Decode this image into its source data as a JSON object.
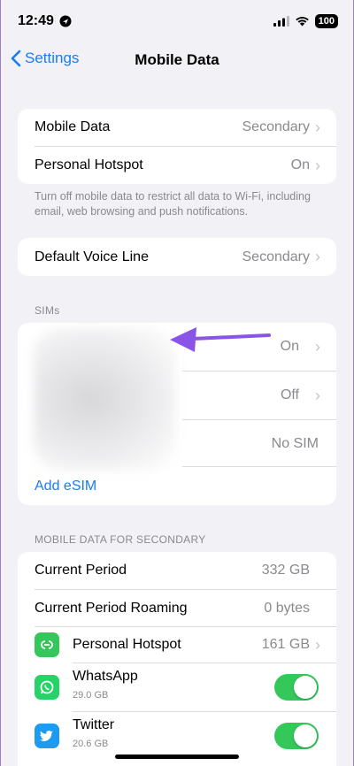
{
  "status_bar": {
    "time": "12:49",
    "battery": "100"
  },
  "nav": {
    "back_label": "Settings",
    "title": "Mobile Data"
  },
  "group1": {
    "mobile_data": {
      "label": "Mobile Data",
      "value": "Secondary"
    },
    "personal_hotspot": {
      "label": "Personal Hotspot",
      "value": "On"
    }
  },
  "footnote": "Turn off mobile data to restrict all data to Wi-Fi, including email, web browsing and push notifications.",
  "voice": {
    "label": "Default Voice Line",
    "value": "Secondary"
  },
  "sims": {
    "header": "SIMs",
    "rows": [
      {
        "value": "On"
      },
      {
        "value": "Off"
      },
      {
        "value": "No SIM"
      }
    ],
    "add_esim": "Add eSIM"
  },
  "usage": {
    "header": "MOBILE DATA FOR SECONDARY",
    "current_period": {
      "label": "Current Period",
      "value": "332 GB"
    },
    "current_roaming": {
      "label": "Current Period Roaming",
      "value": "0 bytes"
    },
    "apps": [
      {
        "name": "Personal Hotspot",
        "value": "161 GB",
        "icon": "hotspot-icon"
      },
      {
        "name": "WhatsApp",
        "sub": "29.0 GB",
        "icon": "whatsapp-icon",
        "enabled": true
      },
      {
        "name": "Twitter",
        "sub": "20.6 GB",
        "icon": "twitter-icon",
        "enabled": true
      }
    ]
  },
  "colors": {
    "accent": "#1a7cf3",
    "toggle_on": "#34c759",
    "annotation_arrow": "#8a55e6"
  }
}
